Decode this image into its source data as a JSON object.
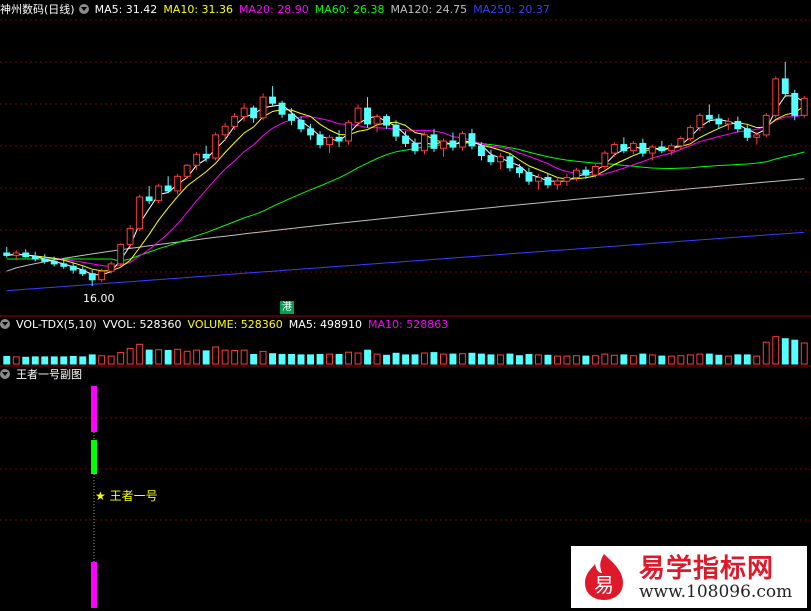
{
  "main_header": {
    "title": "神州数码(日线)",
    "ma5": "MA5: 31.42",
    "ma10": "MA10: 31.36",
    "ma20": "MA20: 28.90",
    "ma60": "MA60: 26.38",
    "ma120": "MA120: 24.75",
    "ma250": "MA250: 20.37"
  },
  "vol_header": {
    "title": "VOL-TDX(5,10)",
    "vvol": "VVOL: 528360",
    "volume": "VOLUME: 528360",
    "ma5": "MA5: 498910",
    "ma10": "MA10: 528863"
  },
  "sub_header": {
    "title": "王者一号副图"
  },
  "annotations": {
    "low_price": "16.00",
    "hk_badge": "港",
    "signal": "★ 王者一号"
  },
  "watermark": {
    "title": "易学指标网",
    "url": "www.108096.com",
    "logo_char": "易"
  },
  "colors": {
    "up": "#ff3b3b",
    "down": "#54ffff",
    "ma5": "#ffffff",
    "ma10": "#ffff00",
    "ma20": "#ff00ff",
    "ma60": "#00ff00",
    "ma120": "#c0c0c0",
    "ma250": "#3c3cff",
    "grid": "#7a0000",
    "signal_magenta": "#ff00ff",
    "signal_green": "#00ff00"
  },
  "chart_data": [
    {
      "type": "candlestick",
      "title": "神州数码(日线)",
      "series_values": {
        "MA5": 31.42,
        "MA10": 31.36,
        "MA20": 28.9,
        "MA60": 26.38,
        "MA120": 24.75,
        "MA250": 20.37
      },
      "ylim": [
        15.0,
        38.0
      ],
      "min_label": 16.0,
      "candles": [
        [
          18.7,
          19.2,
          18.3,
          18.5
        ],
        [
          18.5,
          18.9,
          18.1,
          18.7
        ],
        [
          18.7,
          19.0,
          18.3,
          18.4
        ],
        [
          18.4,
          18.8,
          18.0,
          18.2
        ],
        [
          18.2,
          18.6,
          17.8,
          18.0
        ],
        [
          18.0,
          18.4,
          17.6,
          17.8
        ],
        [
          17.8,
          18.2,
          17.4,
          17.6
        ],
        [
          17.6,
          17.9,
          17.0,
          17.3
        ],
        [
          17.3,
          17.6,
          16.8,
          17.0
        ],
        [
          17.0,
          17.3,
          16.0,
          16.5
        ],
        [
          16.5,
          17.4,
          16.3,
          17.2
        ],
        [
          17.2,
          18.0,
          17.0,
          17.8
        ],
        [
          17.8,
          19.5,
          17.6,
          19.4
        ],
        [
          19.4,
          21.0,
          19.1,
          20.7
        ],
        [
          20.7,
          23.5,
          20.5,
          23.3
        ],
        [
          23.3,
          24.2,
          22.7,
          23.0
        ],
        [
          23.0,
          24.4,
          22.8,
          24.2
        ],
        [
          24.2,
          25.0,
          23.6,
          23.8
        ],
        [
          23.8,
          25.2,
          23.5,
          25.0
        ],
        [
          25.0,
          26.0,
          24.8,
          25.9
        ],
        [
          25.9,
          27.0,
          25.5,
          26.8
        ],
        [
          26.8,
          27.5,
          26.2,
          26.5
        ],
        [
          26.5,
          28.6,
          26.3,
          28.4
        ],
        [
          28.4,
          29.4,
          27.9,
          29.1
        ],
        [
          29.1,
          30.2,
          28.8,
          29.9
        ],
        [
          29.9,
          31.0,
          29.5,
          30.6
        ],
        [
          30.6,
          30.8,
          29.4,
          29.8
        ],
        [
          29.8,
          31.8,
          29.6,
          31.5
        ],
        [
          31.5,
          32.4,
          30.8,
          31.0
        ],
        [
          31.0,
          31.2,
          29.8,
          30.1
        ],
        [
          30.1,
          30.6,
          29.2,
          29.6
        ],
        [
          29.6,
          29.9,
          28.6,
          28.9
        ],
        [
          28.9,
          29.3,
          28.0,
          28.4
        ],
        [
          28.4,
          28.7,
          27.3,
          27.6
        ],
        [
          27.6,
          28.4,
          26.9,
          28.2
        ],
        [
          28.2,
          28.8,
          27.4,
          27.9
        ],
        [
          27.9,
          29.6,
          27.6,
          29.4
        ],
        [
          29.4,
          30.9,
          29.1,
          30.6
        ],
        [
          30.6,
          31.5,
          29.0,
          29.3
        ],
        [
          29.3,
          30.1,
          28.6,
          29.9
        ],
        [
          29.9,
          30.1,
          28.9,
          29.2
        ],
        [
          29.2,
          29.6,
          27.9,
          28.3
        ],
        [
          28.3,
          28.7,
          27.4,
          27.7
        ],
        [
          27.7,
          28.1,
          26.8,
          27.1
        ],
        [
          27.1,
          28.6,
          26.8,
          28.4
        ],
        [
          28.4,
          28.9,
          27.0,
          27.3
        ],
        [
          27.3,
          28.1,
          26.6,
          27.9
        ],
        [
          27.9,
          28.6,
          27.1,
          27.4
        ],
        [
          27.4,
          28.7,
          27.1,
          28.5
        ],
        [
          28.5,
          28.9,
          27.2,
          27.5
        ],
        [
          27.5,
          27.8,
          26.3,
          26.7
        ],
        [
          26.7,
          27.2,
          25.9,
          26.2
        ],
        [
          26.2,
          26.9,
          25.6,
          26.6
        ],
        [
          26.6,
          26.9,
          25.4,
          25.7
        ],
        [
          25.7,
          26.0,
          24.9,
          25.3
        ],
        [
          25.3,
          25.7,
          24.3,
          24.6
        ],
        [
          24.6,
          25.2,
          23.9,
          24.9
        ],
        [
          24.9,
          25.2,
          24.0,
          24.3
        ],
        [
          24.3,
          24.9,
          23.9,
          24.6
        ],
        [
          24.6,
          25.2,
          24.2,
          24.9
        ],
        [
          24.9,
          25.7,
          24.6,
          25.5
        ],
        [
          25.5,
          25.8,
          24.8,
          25.1
        ],
        [
          25.1,
          26.0,
          24.9,
          25.8
        ],
        [
          25.8,
          27.1,
          25.6,
          26.9
        ],
        [
          26.9,
          27.8,
          26.6,
          27.6
        ],
        [
          27.6,
          28.2,
          26.9,
          27.1
        ],
        [
          27.1,
          27.9,
          26.8,
          27.7
        ],
        [
          27.7,
          28.1,
          26.6,
          26.9
        ],
        [
          26.9,
          27.6,
          26.3,
          27.4
        ],
        [
          27.4,
          27.9,
          26.9,
          27.1
        ],
        [
          27.1,
          27.7,
          26.7,
          27.5
        ],
        [
          27.5,
          28.3,
          27.2,
          28.1
        ],
        [
          28.1,
          29.2,
          27.9,
          29.0
        ],
        [
          29.0,
          30.2,
          28.7,
          30.0
        ],
        [
          30.0,
          30.9,
          29.4,
          29.7
        ],
        [
          29.7,
          30.1,
          28.9,
          29.3
        ],
        [
          29.3,
          29.8,
          28.8,
          29.5
        ],
        [
          29.5,
          29.9,
          28.6,
          28.9
        ],
        [
          28.9,
          29.2,
          27.9,
          28.2
        ],
        [
          28.2,
          28.6,
          27.6,
          28.4
        ],
        [
          28.4,
          30.2,
          28.2,
          30.0
        ],
        [
          30.0,
          33.2,
          29.8,
          33.0
        ],
        [
          33.0,
          34.4,
          31.5,
          31.8
        ],
        [
          31.8,
          32.1,
          29.6,
          30.0
        ],
        [
          30.0,
          31.6,
          29.8,
          31.4
        ]
      ]
    },
    {
      "type": "bar",
      "title": "VOL-TDX(5,10)",
      "series_values": {
        "VVOL": 528360,
        "VOLUME": 528360,
        "MA5": 498910,
        "MA10": 528863
      }
    },
    {
      "type": "signal",
      "title": "王者一号副图",
      "segments": [
        "magenta",
        "dotted",
        "green",
        "dotted",
        "magenta"
      ],
      "label": "★ 王者一号"
    }
  ]
}
